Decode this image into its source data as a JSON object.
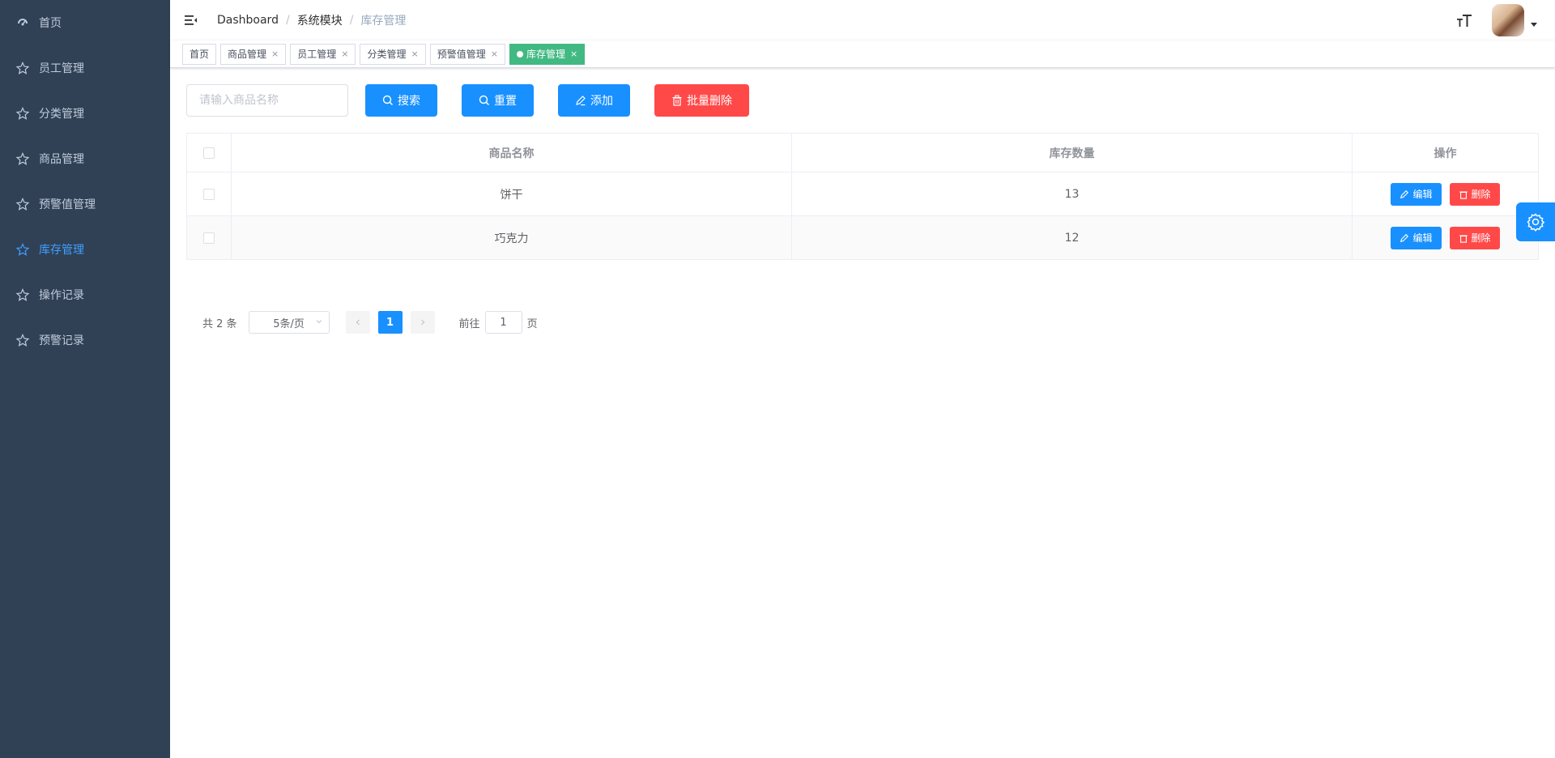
{
  "sidebar": {
    "items": [
      {
        "label": "首页",
        "icon": "dashboard-icon"
      },
      {
        "label": "员工管理",
        "icon": "star-icon"
      },
      {
        "label": "分类管理",
        "icon": "star-icon"
      },
      {
        "label": "商品管理",
        "icon": "star-icon"
      },
      {
        "label": "预警值管理",
        "icon": "star-icon"
      },
      {
        "label": "库存管理",
        "icon": "star-icon",
        "active": true
      },
      {
        "label": "操作记录",
        "icon": "star-icon"
      },
      {
        "label": "预警记录",
        "icon": "star-icon"
      }
    ]
  },
  "breadcrumb": [
    "Dashboard",
    "系统模块",
    "库存管理"
  ],
  "tags": [
    {
      "label": "首页",
      "closable": false
    },
    {
      "label": "商品管理",
      "closable": true
    },
    {
      "label": "员工管理",
      "closable": true
    },
    {
      "label": "分类管理",
      "closable": true
    },
    {
      "label": "预警值管理",
      "closable": true
    },
    {
      "label": "库存管理",
      "closable": true,
      "active": true
    }
  ],
  "toolbar": {
    "search_placeholder": "请输入商品名称",
    "search_label": "搜索",
    "reset_label": "重置",
    "add_label": "添加",
    "batch_delete_label": "批量删除"
  },
  "table": {
    "headers": {
      "name": "商品名称",
      "qty": "库存数量",
      "op": "操作"
    },
    "rows": [
      {
        "name": "饼干",
        "qty": "13"
      },
      {
        "name": "巧克力",
        "qty": "12"
      }
    ],
    "edit_label": "编辑",
    "delete_label": "删除"
  },
  "pagination": {
    "total": "共 2 条",
    "page_size": "5条/页",
    "current": "1",
    "goto_prefix": "前往",
    "goto_value": "1",
    "goto_suffix": "页"
  },
  "colors": {
    "sidebar_bg": "#304156",
    "primary": "#1890ff",
    "danger": "#ff4949",
    "tag_active": "#42b983"
  }
}
